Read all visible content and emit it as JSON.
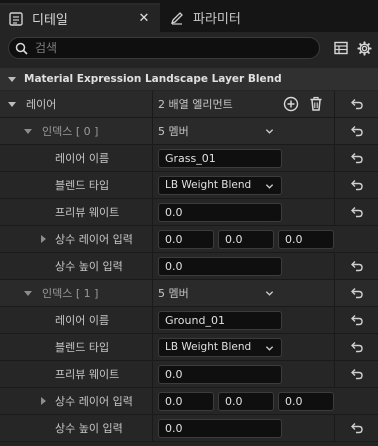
{
  "tabs": [
    {
      "label": "디테일",
      "active": true,
      "close": "✕"
    },
    {
      "label": "파라미터",
      "active": false
    }
  ],
  "search": {
    "placeholder": "검색"
  },
  "section": {
    "title": "Material Expression Landscape Layer Blend"
  },
  "layers": {
    "label": "레이어",
    "value": "2 배열 엘리먼트"
  },
  "indices": [
    {
      "label": "인덱스 [ 0 ]",
      "value": "5 멤버",
      "layer_name_label": "레이어 이름",
      "layer_name": "Grass_01",
      "blend_type_label": "블렌드 타입",
      "blend_type": "LB Weight Blend",
      "preview_weight_label": "프리뷰 웨이트",
      "preview_weight": "0.0",
      "const_layer_input_label": "상수 레이어 입력",
      "const_layer_input": [
        "0.0",
        "0.0",
        "0.0"
      ],
      "const_height_input_label": "상수 높이 입력",
      "const_height_input": "0.0"
    },
    {
      "label": "인덱스 [ 1 ]",
      "value": "5 멤버",
      "layer_name_label": "레이어 이름",
      "layer_name": "Ground_01",
      "blend_type_label": "블렌드 타입",
      "blend_type": "LB Weight Blend",
      "preview_weight_label": "프리뷰 웨이트",
      "preview_weight": "0.0",
      "const_layer_input_label": "상수 레이어 입력",
      "const_layer_input": [
        "0.0",
        "0.0",
        "0.0"
      ],
      "const_height_input_label": "상수 높이 입력",
      "const_height_input": "0.0"
    }
  ],
  "colors": {
    "panel": "#242424",
    "row": "#2a2a2a",
    "field": "#0f0f0f",
    "tabbar": "#151515"
  }
}
